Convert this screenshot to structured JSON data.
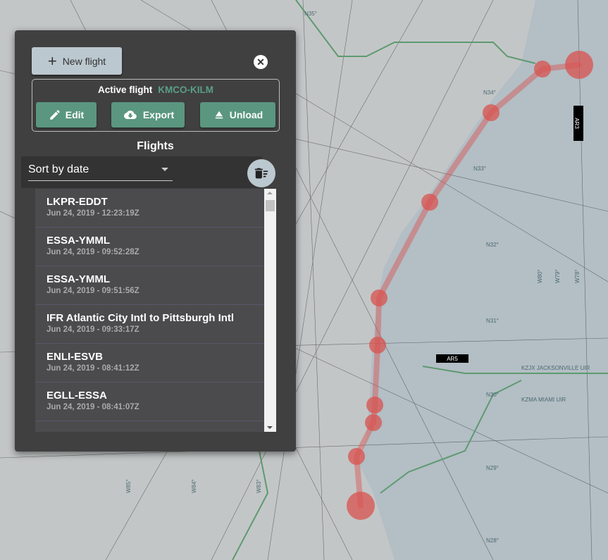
{
  "map": {
    "labels": {
      "lat": [
        "N35°",
        "N34°",
        "N33°",
        "N32°",
        "N31°",
        "N30°",
        "N29°",
        "N28°"
      ],
      "lon": [
        "W80°",
        "W79°",
        "W78°",
        "W84°",
        "W83°",
        "W85°"
      ],
      "airways": [
        "AR3",
        "AR5"
      ],
      "regions": [
        "KZJX JACKSONVILLE UIR",
        "KZMA MIAMI UIR"
      ]
    },
    "colors": {
      "sea": "#b3bec5",
      "land": "#c3c6c7",
      "boundary": "#5e9a70",
      "route": "#d9534f"
    }
  },
  "panel": {
    "new_flight_label": "New flight",
    "close_icon": "close-icon",
    "active": {
      "label": "Active flight",
      "name": "KMCO-KILM",
      "edit": "Edit",
      "export": "Export",
      "unload": "Unload"
    },
    "flights_heading": "Flights",
    "sort": {
      "selected": "Sort by date"
    },
    "flights": [
      {
        "title": "LKPR-EDDT",
        "date": "Jun 24, 2019 - 12:23:19Z"
      },
      {
        "title": "ESSA-YMML",
        "date": "Jun 24, 2019 - 09:52:28Z"
      },
      {
        "title": "ESSA-YMML",
        "date": "Jun 24, 2019 - 09:51:56Z"
      },
      {
        "title": "IFR Atlantic City Intl to Pittsburgh Intl",
        "date": "Jun 24, 2019 - 09:33:17Z"
      },
      {
        "title": "ENLI-ESVB",
        "date": "Jun 24, 2019 - 08:41:12Z"
      },
      {
        "title": "EGLL-ESSA",
        "date": "Jun 24, 2019 - 08:41:07Z"
      }
    ]
  }
}
